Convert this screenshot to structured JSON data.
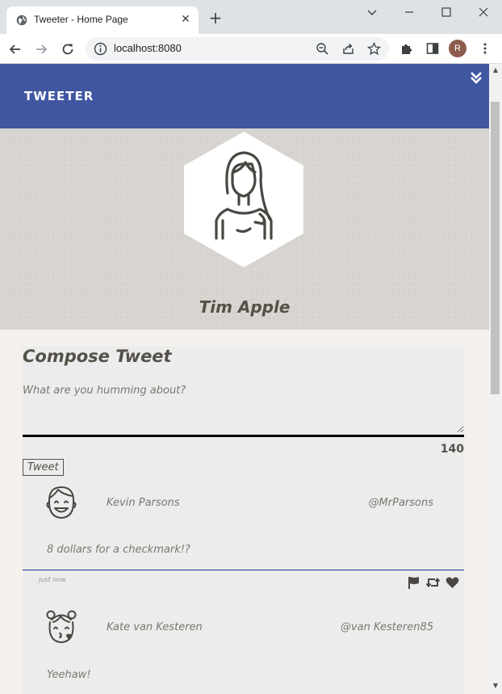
{
  "browser": {
    "tab_title": "Tweeter - Home Page",
    "close_glyph": "✕",
    "new_tab_glyph": "+",
    "url": "localhost:8080",
    "profile_initial": "R"
  },
  "nav": {
    "brand": "TWEETER"
  },
  "profile": {
    "name": "Tim Apple",
    "avatar_icon": "hexagon-avatar-icon"
  },
  "compose": {
    "title": "Compose Tweet",
    "placeholder": "What are you humming about?",
    "counter": "140",
    "submit_label": "Tweet"
  },
  "tweets": [
    {
      "name": "Kevin Parsons",
      "handle": "@MrParsons",
      "content": "8 dollars for a checkmark!?",
      "time": "just now",
      "avatar_icon": "smiling-boy-avatar-icon"
    },
    {
      "name": "Kate van Kesteren",
      "handle": "@van Kesteren85",
      "content": "Yeehaw!",
      "avatar_icon": "kissing-girl-avatar-icon"
    }
  ],
  "colors": {
    "nav_bg": "#4056a1",
    "page_bg": "#f4f1ec",
    "text": "#545149",
    "divider": "#1f2a9c"
  }
}
